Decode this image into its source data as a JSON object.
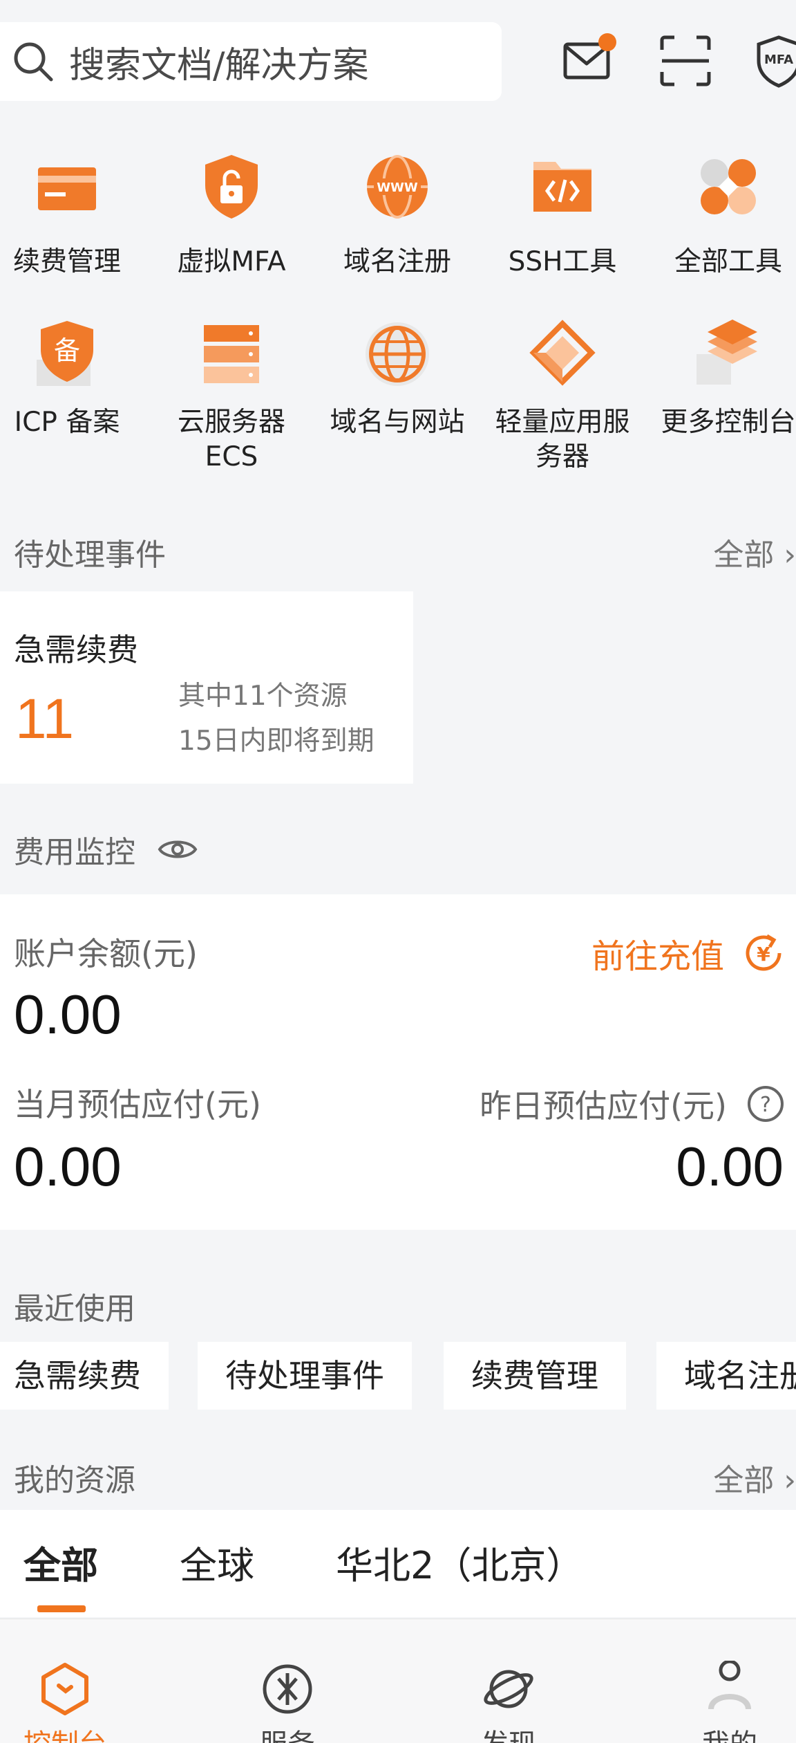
{
  "header": {
    "search_placeholder": "搜索文档/解决方案",
    "icons": [
      "search-icon",
      "mail-icon",
      "scan-icon",
      "mfa-icon"
    ],
    "mfa_text": "MFA"
  },
  "tools": [
    {
      "label": "续费管理",
      "icon": "renew-card-icon"
    },
    {
      "label": "虚拟MFA",
      "icon": "shield-lock-icon"
    },
    {
      "label": "域名注册",
      "icon": "www-globe-icon"
    },
    {
      "label": "SSH工具",
      "icon": "code-folder-icon"
    },
    {
      "label": "全部工具",
      "icon": "all-tools-icon"
    },
    {
      "label": "ICP 备案",
      "icon": "icp-filing-icon"
    },
    {
      "label": "云服务器\nECS",
      "icon": "server-icon"
    },
    {
      "label": "域名与网站",
      "icon": "globe-icon"
    },
    {
      "label": "轻量应用服\n务器",
      "icon": "cube-icon"
    },
    {
      "label": "更多控制台",
      "icon": "layers-icon"
    }
  ],
  "pending": {
    "title": "待处理事件",
    "more": "全部 ›",
    "card_title": "急需续费",
    "count": "11",
    "desc_line1": "其中11个资源",
    "desc_line2": "15日内即将到期"
  },
  "cost": {
    "title": "费用监控",
    "balance_label": "账户余额(元)",
    "balance_value": "0.00",
    "recharge_label": "前往充值",
    "month_label": "当月预估应付(元)",
    "month_value": "0.00",
    "yesterday_label": "昨日预估应付(元)",
    "yesterday_value": "0.00"
  },
  "recent": {
    "title": "最近使用",
    "items": [
      "急需续费",
      "待处理事件",
      "续费管理",
      "域名注册"
    ]
  },
  "resources": {
    "title": "我的资源",
    "more": "全部 ›",
    "tabs": [
      "全部",
      "全球",
      "华北2（北京）"
    ]
  },
  "bottom_nav": [
    {
      "label": "控制台",
      "icon": "console-icon",
      "active": true
    },
    {
      "label": "服务",
      "icon": "service-icon",
      "active": false
    },
    {
      "label": "发现",
      "icon": "planet-icon",
      "active": false
    },
    {
      "label": "我的",
      "icon": "profile-icon",
      "active": false
    }
  ],
  "colors": {
    "accent": "#f0741e",
    "background": "#f4f5f7"
  }
}
